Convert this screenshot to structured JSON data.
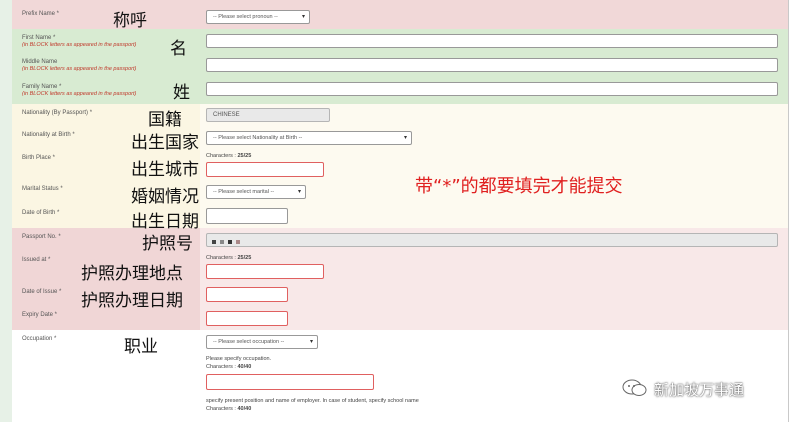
{
  "form": {
    "prefix_label": "Prefix Name *",
    "prefix_cn": "称呼",
    "prefix_select": "-- Please select pronoun --",
    "first_label": "First Name *",
    "first_hint": "(in BLOCK letters as appeared in the passport)",
    "first_cn": "名",
    "middle_label": "Middle Name",
    "middle_hint": "(in BLOCK letters as appeared in the passport)",
    "family_label": "Family Name *",
    "family_hint": "(in BLOCK letters as appeared in the passport)",
    "family_cn": "姓",
    "nationality_label": "Nationality (By Passport) *",
    "nationality_cn": "国籍",
    "nationality_value": "CHINESE",
    "nat_birth_label": "Nationality at Birth *",
    "nat_birth_cn": "出生国家",
    "nat_birth_select": "-- Please select Nationality at Birth --",
    "birth_place_label": "Birth Place *",
    "birth_place_cn": "出生城市",
    "birth_place_chars_label": "Characters :",
    "birth_place_chars_value": "25/25",
    "marital_label": "Marital Status *",
    "marital_cn": "婚姻情况",
    "marital_select": "-- Please select marital --",
    "dob_label": "Date of Birth *",
    "dob_cn": "出生日期",
    "passport_label": "Passport No. *",
    "passport_cn": "护照号",
    "issued_label": "Issued at *",
    "issued_cn": "护照办理地点",
    "issued_chars_label": "Characters :",
    "issued_chars_value": "25/25",
    "doi_label": "Date of Issue *",
    "doi_cn": "护照办理日期",
    "expiry_label": "Expiry Date *",
    "occupation_label": "Occupation *",
    "occupation_cn": "职业",
    "occupation_select": "-- Please select occupation --",
    "occupation_note": "Please specify occupation.",
    "occupation_chars_label": "Characters :",
    "occupation_chars_value": "40/40",
    "employer_note": "specify present position and name of employer. In case of student, specify school name",
    "employer_chars_label": "Characters :",
    "employer_chars_value": "40/40"
  },
  "annotation": {
    "required_note": "带“*”的都要填完才能提交"
  },
  "watermark": {
    "text": "新加坡万事通"
  },
  "colors": {
    "pink_band": "#f1d8d8",
    "green_band": "#d8ebd2",
    "yellow_band": "#fbf6e3",
    "red_text": "#e02020"
  }
}
